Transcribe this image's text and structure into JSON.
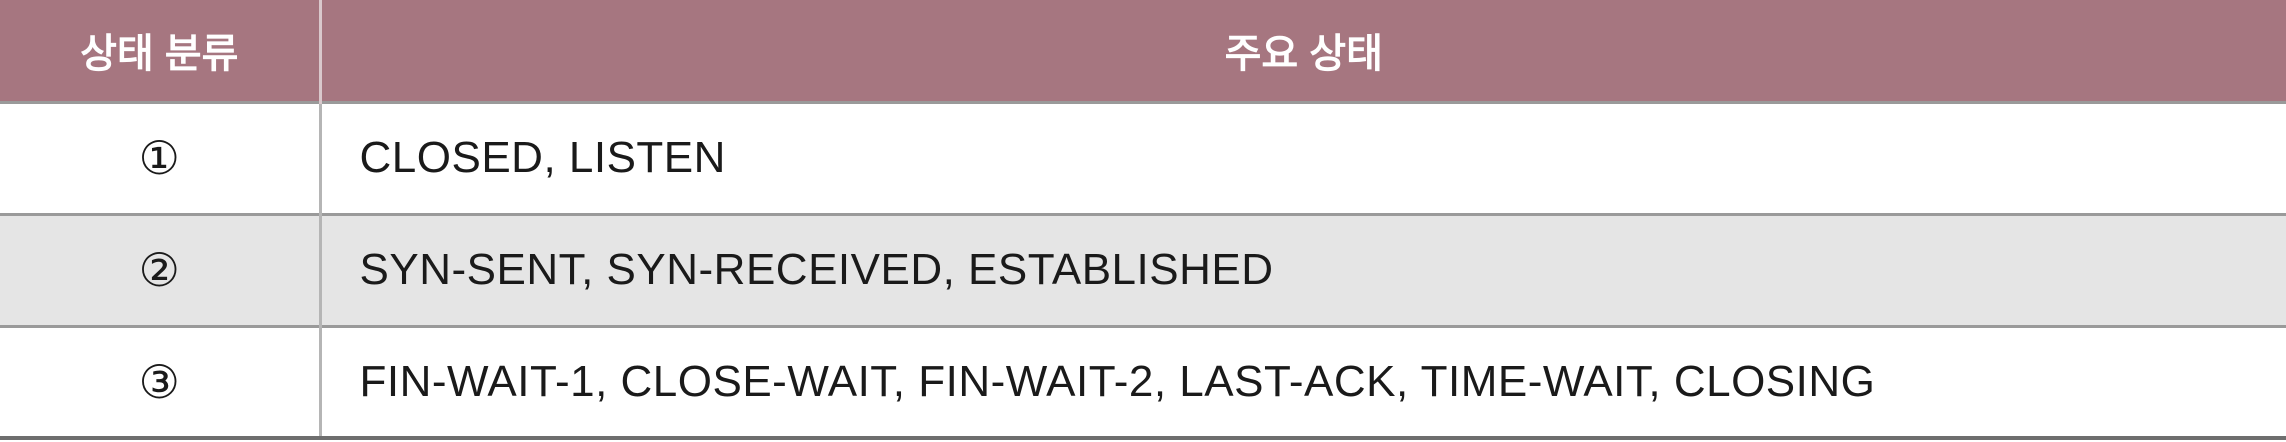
{
  "table": {
    "headers": {
      "category": "상태 분류",
      "main_states": "주요 상태"
    },
    "rows": [
      {
        "category": "①",
        "states": "CLOSED, LISTEN"
      },
      {
        "category": "②",
        "states": "SYN-SENT, SYN-RECEIVED, ESTABLISHED"
      },
      {
        "category": "③",
        "states": "FIN-WAIT-1, CLOSE-WAIT, FIN-WAIT-2, LAST-ACK, TIME-WAIT, CLOSING"
      }
    ]
  },
  "colors": {
    "header_bg": "#a67680",
    "header_text": "#ffffff",
    "row_alt_bg": "#e5e5e5",
    "row_bg": "#ffffff"
  }
}
